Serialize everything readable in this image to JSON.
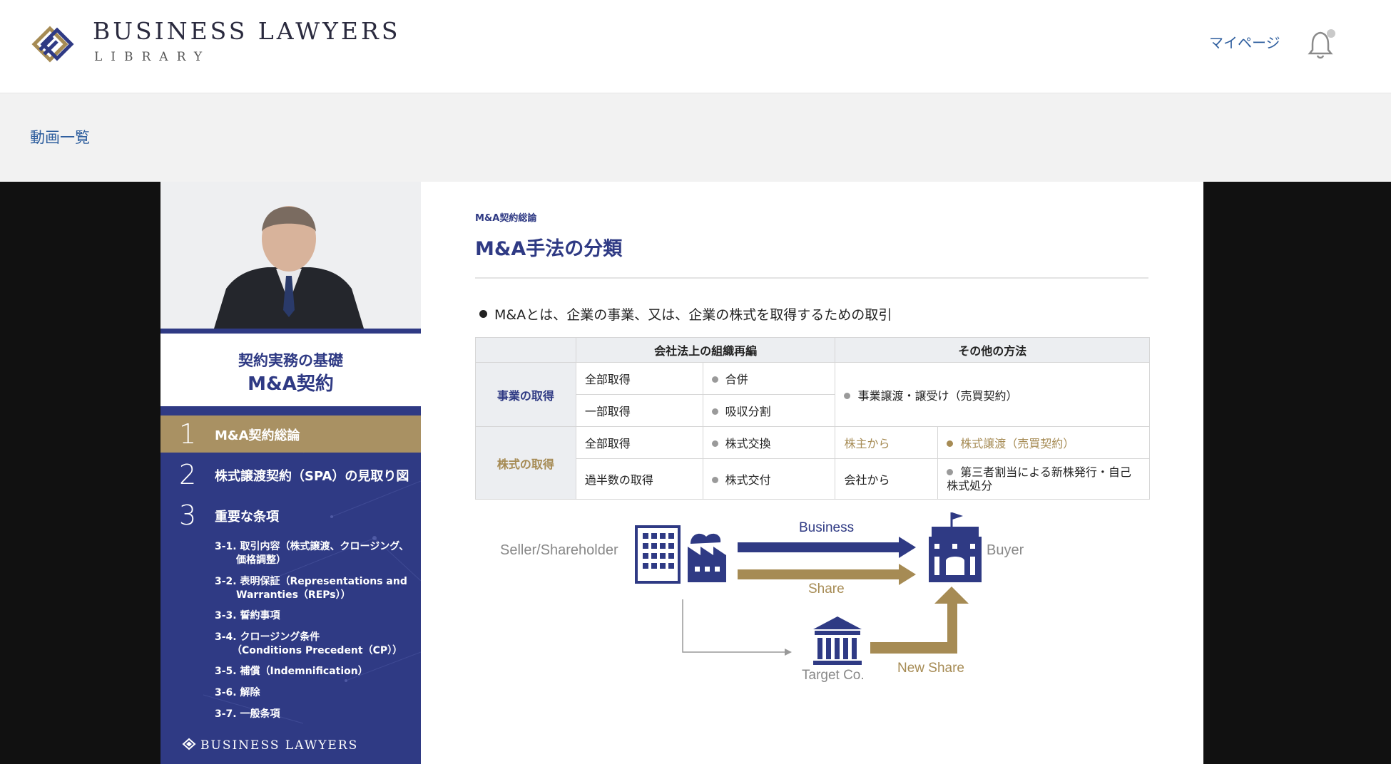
{
  "header": {
    "logo_title": "BUSINESS LAWYERS",
    "logo_subtitle": "LIBRARY",
    "mypage_label": "マイページ",
    "notification_icon": "bell-icon"
  },
  "breadcrumb": {
    "label": "動画一覧"
  },
  "course": {
    "subtitle": "契約実務の基礎",
    "title": "M&A契約",
    "chapters": [
      {
        "num": "1",
        "label": "M&A契約総論",
        "active": true
      },
      {
        "num": "2",
        "label": "株式譲渡契約（SPA）の見取り図",
        "active": false
      },
      {
        "num": "3",
        "label": "重要な条項",
        "active": false
      }
    ],
    "sub_items": [
      {
        "line1": "3-1. 取引内容（株式譲渡、クロージング、",
        "line2": "価格調整）"
      },
      {
        "line1": "3-2. 表明保証（Representations and",
        "line2": "Warranties（REPs））"
      },
      {
        "line1": "3-3. 誓約事項",
        "line2": ""
      },
      {
        "line1": "3-4. クロージング条件",
        "line2": "（Conditions Precedent（CP））"
      },
      {
        "line1": "3-5. 補償（Indemnification）",
        "line2": ""
      },
      {
        "line1": "3-6. 解除",
        "line2": ""
      },
      {
        "line1": "3-7. 一般条項",
        "line2": ""
      }
    ],
    "footer_logo": "BUSINESS LAWYERS"
  },
  "slide": {
    "kicker": "M&A契約総論",
    "title": "M&A手法の分類",
    "bullet": "M&Aとは、企業の事業、又は、企業の株式を取得するための取引",
    "table": {
      "head": {
        "col_reorg": "会社法上の組織再編",
        "col_other": "その他の方法"
      },
      "business_group": "事業の取得",
      "business_rows": [
        {
          "label": "全部取得",
          "method": "合併"
        },
        {
          "label": "一部取得",
          "method": "吸収分割"
        }
      ],
      "business_other": "事業譲渡・譲受け（売買契約）",
      "share_group": "株式の取得",
      "share_rows": [
        {
          "label": "全部取得",
          "method": "株式交換",
          "other_from": "株主から",
          "other_method": "株式譲渡（売買契約）"
        },
        {
          "label": "過半数の取得",
          "method": "株式交付",
          "other_from": "会社から",
          "other_method": "第三者割当による新株発行・自己株式処分"
        }
      ]
    },
    "diagram": {
      "seller": "Seller/Shareholder",
      "buyer": "Buyer",
      "business": "Business",
      "share": "Share",
      "target": "Target Co.",
      "new_share": "New Share",
      "colors": {
        "navy": "#2f3a84",
        "gold": "#a68b54"
      }
    }
  }
}
